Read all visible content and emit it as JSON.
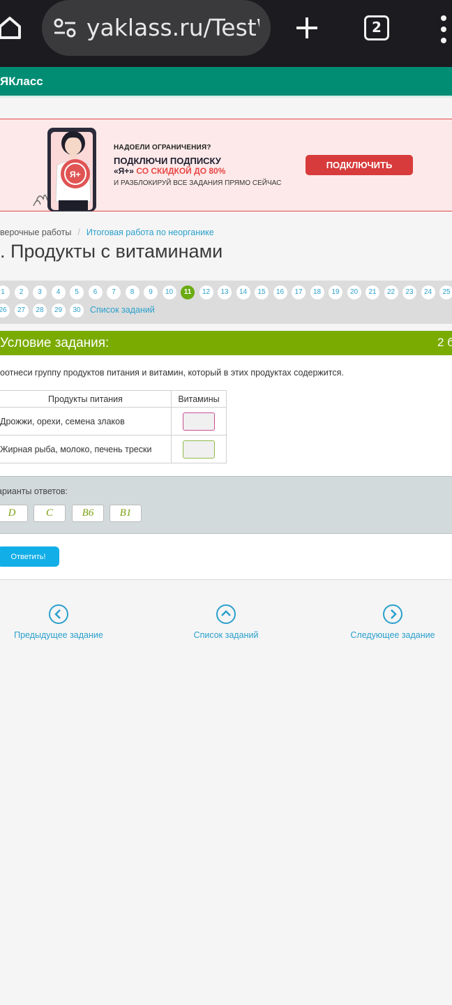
{
  "browser": {
    "url": "yaklass.ru/TestWo",
    "tab_count": "2",
    "icons": [
      "home-icon",
      "site-settings-icon",
      "new-tab-icon",
      "tabs-icon",
      "menu-icon"
    ]
  },
  "site": {
    "logo": "ЯКласс",
    "brand_color": "#008d74"
  },
  "banner": {
    "small": "НАДОЕЛИ ОГРАНИЧЕНИЯ?",
    "line1": "ПОДКЛЮЧИ ПОДПИСКУ",
    "line2_plan": "«Я+»",
    "line2_offer": "СО СКИДКОЙ ДО 80%",
    "line3": "И РАЗБЛОКИРУЙ ВСЕ ЗАДАНИЯ ПРЯМО СЕЙЧАС",
    "button": "ПОДКЛЮЧИТЬ",
    "badge": "Я+"
  },
  "breadcrumb": {
    "item1": "верочные работы",
    "separator": "/",
    "item2": "Итоговая работа по неорганике"
  },
  "page_title": ". Продукты с витаминами",
  "task_nav": {
    "numbers": [
      "1",
      "2",
      "3",
      "4",
      "5",
      "6",
      "7",
      "8",
      "9",
      "10",
      "11",
      "12",
      "13",
      "14",
      "15",
      "16",
      "17",
      "18",
      "19",
      "20",
      "21",
      "22",
      "23",
      "24",
      "25",
      "26",
      "27",
      "28",
      "29",
      "30"
    ],
    "active": "11",
    "list_link": "Список заданий"
  },
  "condition": {
    "title": "Условие задания:",
    "points": "2 б",
    "question": "оотнеси группу продуктов питания и витамин, который в этих продуктах содержится.",
    "table": {
      "headers": [
        "Продукты питания",
        "Витамины"
      ],
      "rows": [
        "Дрожжи, орехи, семена злаков",
        "Жирная рыба, молоко, печень трески"
      ]
    }
  },
  "answers": {
    "label": "арианты ответов:",
    "options": [
      "D",
      "C",
      "B6",
      "B1"
    ]
  },
  "submit_label": "Ответить!",
  "bottom_nav": {
    "prev": "Предыдущее задание",
    "list": "Список заданий",
    "next": "Следующее задание"
  }
}
